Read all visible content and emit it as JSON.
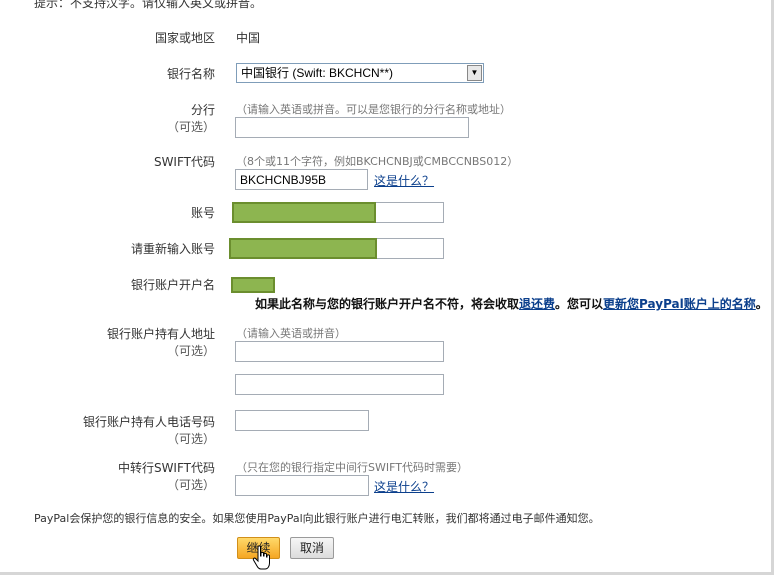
{
  "notice": {
    "text": "提示：不支持汉字。请仅输入英文或拼音。"
  },
  "form": {
    "country": {
      "label": "国家或地区",
      "value": "中国"
    },
    "bank_name": {
      "label": "银行名称",
      "selected": "中国银行 (Swift: BKCHCN**)"
    },
    "branch": {
      "label": "分行",
      "optional": "（可选）",
      "hint": "（请输入英语或拼音。可以是您银行的分行名称或地址）",
      "value": ""
    },
    "swift": {
      "label": "SWIFT代码",
      "hint": "（8个或11个字符，例如BKCHCNBJ或CMBCCNBS012）",
      "value": "BKCHCNBJ95B",
      "help_link": "这是什么？"
    },
    "account": {
      "label": "账号"
    },
    "account_confirm": {
      "label": "请重新输入账号"
    },
    "holder_name": {
      "label": "银行账户开户名",
      "warning_pre": "如果此名称与您的银行账户开户名不符，将会收取",
      "warning_link1": "退还费",
      "warning_mid": "。您可以",
      "warning_link2": "更新您PayPal账户上的名称",
      "warning_post": "。"
    },
    "holder_address": {
      "label": "银行账户持有人地址",
      "optional": "（可选）",
      "hint": "（请输入英语或拼音）"
    },
    "holder_phone": {
      "label": "银行账户持有人电话号码",
      "optional": "（可选）"
    },
    "intermediary_swift": {
      "label": "中转行SWIFT代码",
      "optional": "（可选）",
      "hint": "（只在您的银行指定中间行SWIFT代码时需要）",
      "help_link": "这是什么？"
    }
  },
  "security_note": "PayPal会保护您的银行信息的安全。如果您使用PayPal向此银行账户进行电汇转账，我们都将通过电子邮件通知您。",
  "buttons": {
    "continue": "继续",
    "cancel": "取消"
  },
  "colors": {
    "link": "#0b3f8c",
    "redaction": "#8db550",
    "primary_button": "#f5a622"
  },
  "icons": {
    "cursor": "hand-pointer-icon",
    "dropdown": "chevron-down-icon"
  }
}
